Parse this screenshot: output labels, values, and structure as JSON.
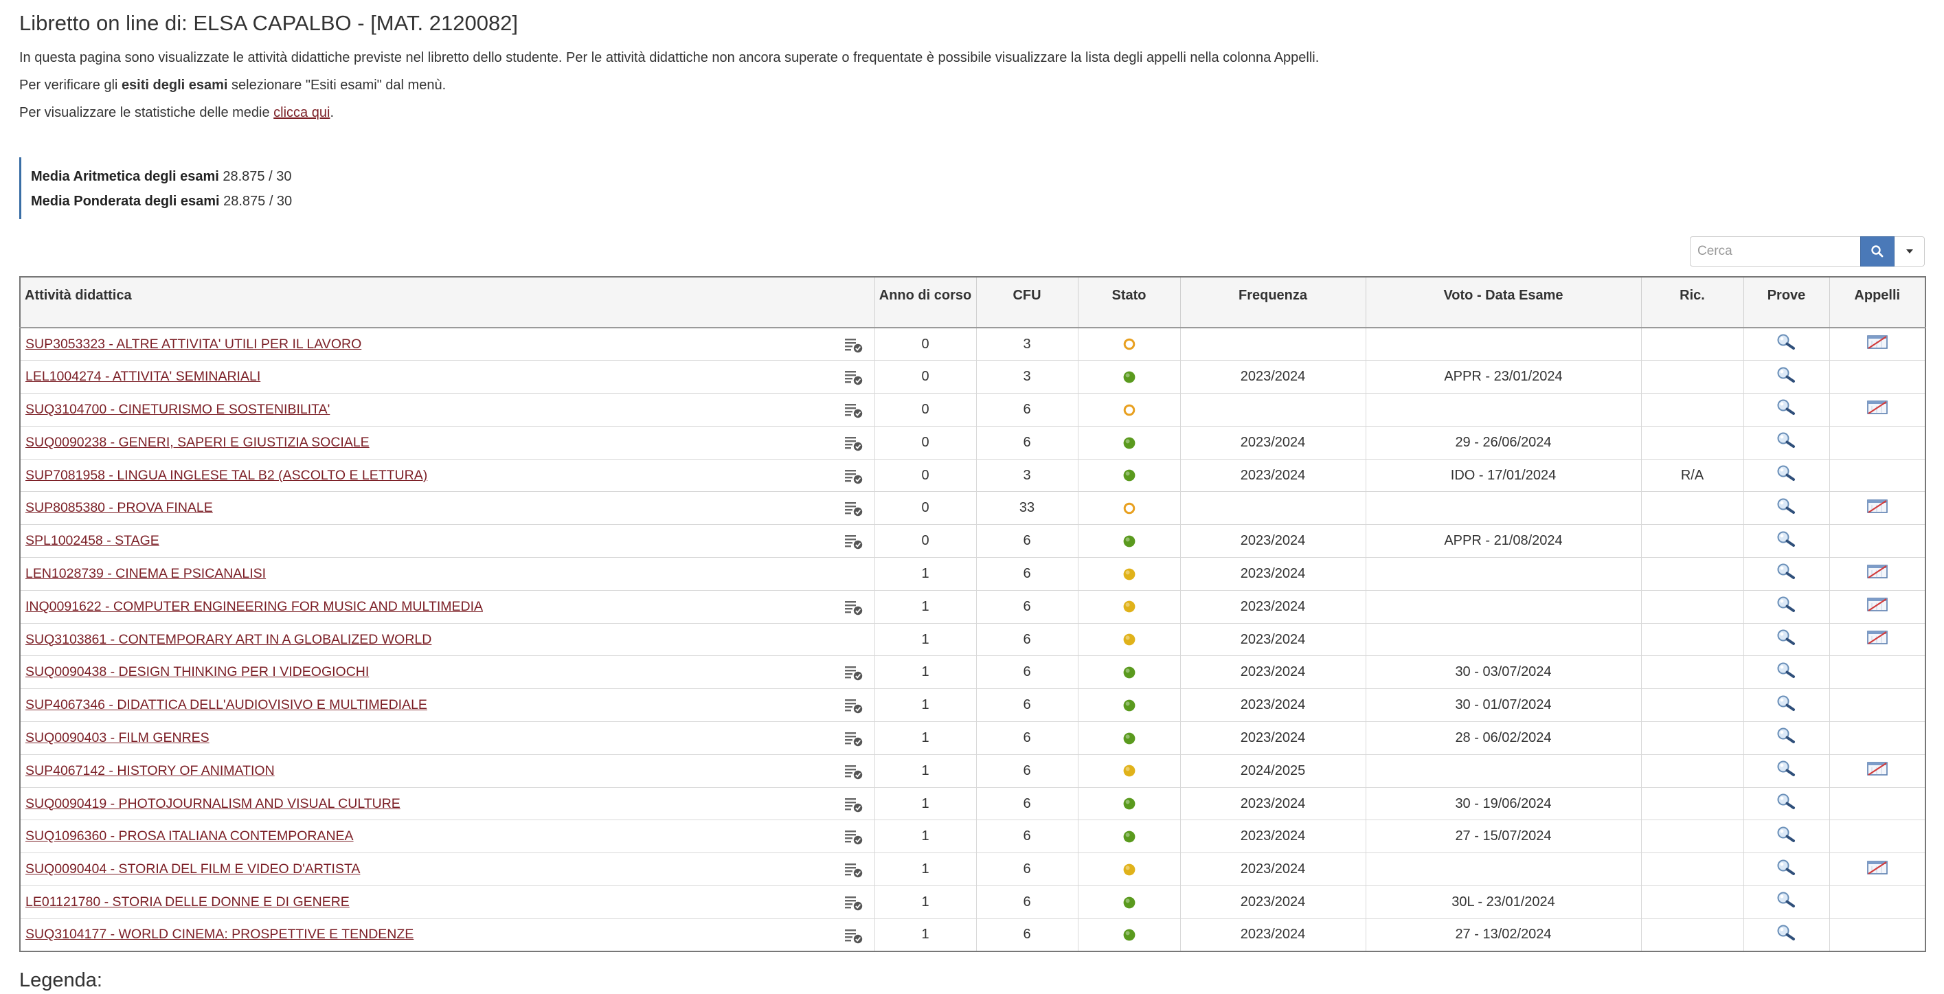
{
  "header": {
    "title": "Libretto on line di: ELSA CAPALBO - [MAT. 2120082]"
  },
  "intro": {
    "line1": "In questa pagina sono visualizzate le attività didattiche previste nel libretto dello studente. Per le attività didattiche non ancora superate o frequentate è possibile visualizzare la lista degli appelli nella colonna Appelli.",
    "line2_prefix": "Per verificare gli ",
    "line2_bold": "esiti degli esami",
    "line2_suffix": " selezionare \"Esiti esami\" dal menù.",
    "line3_prefix": "Per visualizzare le statistiche delle medie ",
    "line3_link": "clicca qui",
    "line3_suffix": "."
  },
  "medie": {
    "aritmetica_label": "Media Aritmetica degli esami",
    "aritmetica_value": " 28.875 / 30",
    "ponderata_label": "Media Ponderata degli esami",
    "ponderata_value": " 28.875 / 30"
  },
  "search": {
    "placeholder": "Cerca"
  },
  "table": {
    "columns": {
      "attivita": "Attività didattica",
      "anno": "Anno di corso",
      "cfu": "CFU",
      "stato": "Stato",
      "frequenza": "Frequenza",
      "voto": "Voto - Data Esame",
      "ric": "Ric.",
      "prove": "Prove",
      "appelli": "Appelli"
    },
    "status_colors": {
      "superata": "#5a9a1e",
      "frequentata": "#e0b21a",
      "pianificata": "#e8a020"
    },
    "rows": [
      {
        "attivita": "SUP3053323 - ALTRE ATTIVITA' UTILI PER IL LAVORO",
        "detail_icon": true,
        "anno": "0",
        "cfu": "3",
        "stato": "pianificata",
        "frequenza": "",
        "voto": "",
        "ric": "",
        "appelli": true
      },
      {
        "attivita": "LEL1004274 - ATTIVITA' SEMINARIALI",
        "detail_icon": true,
        "anno": "0",
        "cfu": "3",
        "stato": "superata",
        "frequenza": "2023/2024",
        "voto": "APPR - 23/01/2024",
        "ric": "",
        "appelli": false
      },
      {
        "attivita": "SUQ3104700 - CINETURISMO E SOSTENIBILITA'",
        "detail_icon": true,
        "anno": "0",
        "cfu": "6",
        "stato": "pianificata",
        "frequenza": "",
        "voto": "",
        "ric": "",
        "appelli": true
      },
      {
        "attivita": "SUQ0090238 - GENERI, SAPERI E GIUSTIZIA SOCIALE",
        "detail_icon": true,
        "anno": "0",
        "cfu": "6",
        "stato": "superata",
        "frequenza": "2023/2024",
        "voto": "29 - 26/06/2024",
        "ric": "",
        "appelli": false
      },
      {
        "attivita": "SUP7081958 - LINGUA INGLESE TAL B2 (ASCOLTO E LETTURA)",
        "detail_icon": true,
        "anno": "0",
        "cfu": "3",
        "stato": "superata",
        "frequenza": "2023/2024",
        "voto": "IDO - 17/01/2024",
        "ric": "R/A",
        "appelli": false
      },
      {
        "attivita": "SUP8085380 - PROVA FINALE",
        "detail_icon": true,
        "anno": "0",
        "cfu": "33",
        "stato": "pianificata",
        "frequenza": "",
        "voto": "",
        "ric": "",
        "appelli": true
      },
      {
        "attivita": "SPL1002458 - STAGE",
        "detail_icon": true,
        "anno": "0",
        "cfu": "6",
        "stato": "superata",
        "frequenza": "2023/2024",
        "voto": "APPR - 21/08/2024",
        "ric": "",
        "appelli": false
      },
      {
        "attivita": "LEN1028739 - CINEMA E PSICANALISI",
        "detail_icon": false,
        "anno": "1",
        "cfu": "6",
        "stato": "frequentata",
        "frequenza": "2023/2024",
        "voto": "",
        "ric": "",
        "appelli": true
      },
      {
        "attivita": "INQ0091622 - COMPUTER ENGINEERING FOR MUSIC AND MULTIMEDIA",
        "detail_icon": true,
        "anno": "1",
        "cfu": "6",
        "stato": "frequentata",
        "frequenza": "2023/2024",
        "voto": "",
        "ric": "",
        "appelli": true
      },
      {
        "attivita": "SUQ3103861 - CONTEMPORARY ART IN A GLOBALIZED WORLD",
        "detail_icon": false,
        "anno": "1",
        "cfu": "6",
        "stato": "frequentata",
        "frequenza": "2023/2024",
        "voto": "",
        "ric": "",
        "appelli": true
      },
      {
        "attivita": "SUQ0090438 - DESIGN THINKING PER I VIDEOGIOCHI",
        "detail_icon": true,
        "anno": "1",
        "cfu": "6",
        "stato": "superata",
        "frequenza": "2023/2024",
        "voto": "30 - 03/07/2024",
        "ric": "",
        "appelli": false
      },
      {
        "attivita": "SUP4067346 - DIDATTICA DELL'AUDIOVISIVO E MULTIMEDIALE",
        "detail_icon": true,
        "anno": "1",
        "cfu": "6",
        "stato": "superata",
        "frequenza": "2023/2024",
        "voto": "30 - 01/07/2024",
        "ric": "",
        "appelli": false
      },
      {
        "attivita": "SUQ0090403 - FILM GENRES",
        "detail_icon": true,
        "anno": "1",
        "cfu": "6",
        "stato": "superata",
        "frequenza": "2023/2024",
        "voto": "28 - 06/02/2024",
        "ric": "",
        "appelli": false
      },
      {
        "attivita": "SUP4067142 - HISTORY OF ANIMATION",
        "detail_icon": true,
        "anno": "1",
        "cfu": "6",
        "stato": "frequentata",
        "frequenza": "2024/2025",
        "voto": "",
        "ric": "",
        "appelli": true
      },
      {
        "attivita": "SUQ0090419 - PHOTOJOURNALISM AND VISUAL CULTURE",
        "detail_icon": true,
        "anno": "1",
        "cfu": "6",
        "stato": "superata",
        "frequenza": "2023/2024",
        "voto": "30 - 19/06/2024",
        "ric": "",
        "appelli": false
      },
      {
        "attivita": "SUQ1096360 - PROSA ITALIANA CONTEMPORANEA",
        "detail_icon": true,
        "anno": "1",
        "cfu": "6",
        "stato": "superata",
        "frequenza": "2023/2024",
        "voto": "27 - 15/07/2024",
        "ric": "",
        "appelli": false
      },
      {
        "attivita": "SUQ0090404 - STORIA DEL FILM E VIDEO D'ARTISTA",
        "detail_icon": true,
        "anno": "1",
        "cfu": "6",
        "stato": "frequentata",
        "frequenza": "2023/2024",
        "voto": "",
        "ric": "",
        "appelli": true
      },
      {
        "attivita": "LE01121780 - STORIA DELLE DONNE E DI GENERE",
        "detail_icon": true,
        "anno": "1",
        "cfu": "6",
        "stato": "superata",
        "frequenza": "2023/2024",
        "voto": "30L - 23/01/2024",
        "ric": "",
        "appelli": false
      },
      {
        "attivita": "SUQ3104177 - WORLD CINEMA: PROSPETTIVE E TENDENZE",
        "detail_icon": true,
        "anno": "1",
        "cfu": "6",
        "stato": "superata",
        "frequenza": "2023/2024",
        "voto": "27 - 13/02/2024",
        "ric": "",
        "appelli": false
      }
    ]
  },
  "legend": {
    "title": "Legenda:"
  }
}
